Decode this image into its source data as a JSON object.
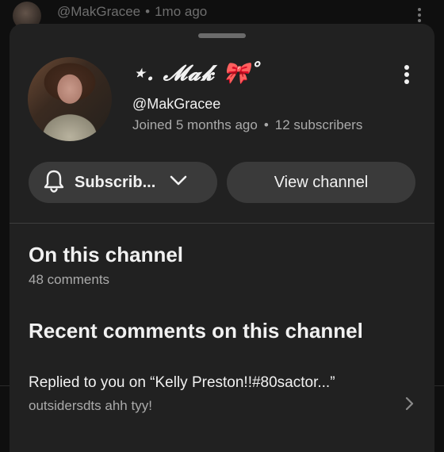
{
  "background_comment": {
    "author": "@MakGracee",
    "separator": "•",
    "time": "1mo ago"
  },
  "sheet": {
    "channel_name": "⋆. 𝓜𝓪𝓴 🎀˚",
    "handle": "@MakGracee",
    "joined": "Joined 5 months ago",
    "separator": "•",
    "subscribers": "12 subscribers",
    "subscribe_label": "Subscrib...",
    "view_channel_label": "View channel",
    "on_channel": {
      "title": "On this channel",
      "comments_count": "48 comments"
    },
    "recent": {
      "title": "Recent comments on this channel",
      "items": [
        {
          "title": "Replied to you on “Kelly Preston!!#80sactor...”",
          "preview": "outsidersdts ahh tyy!"
        }
      ]
    }
  },
  "colors": {
    "background": "#0f0f0f",
    "sheet": "#212121",
    "button": "#3a3a3a",
    "text": "#f1f1f1",
    "muted": "#aaaaaa"
  }
}
